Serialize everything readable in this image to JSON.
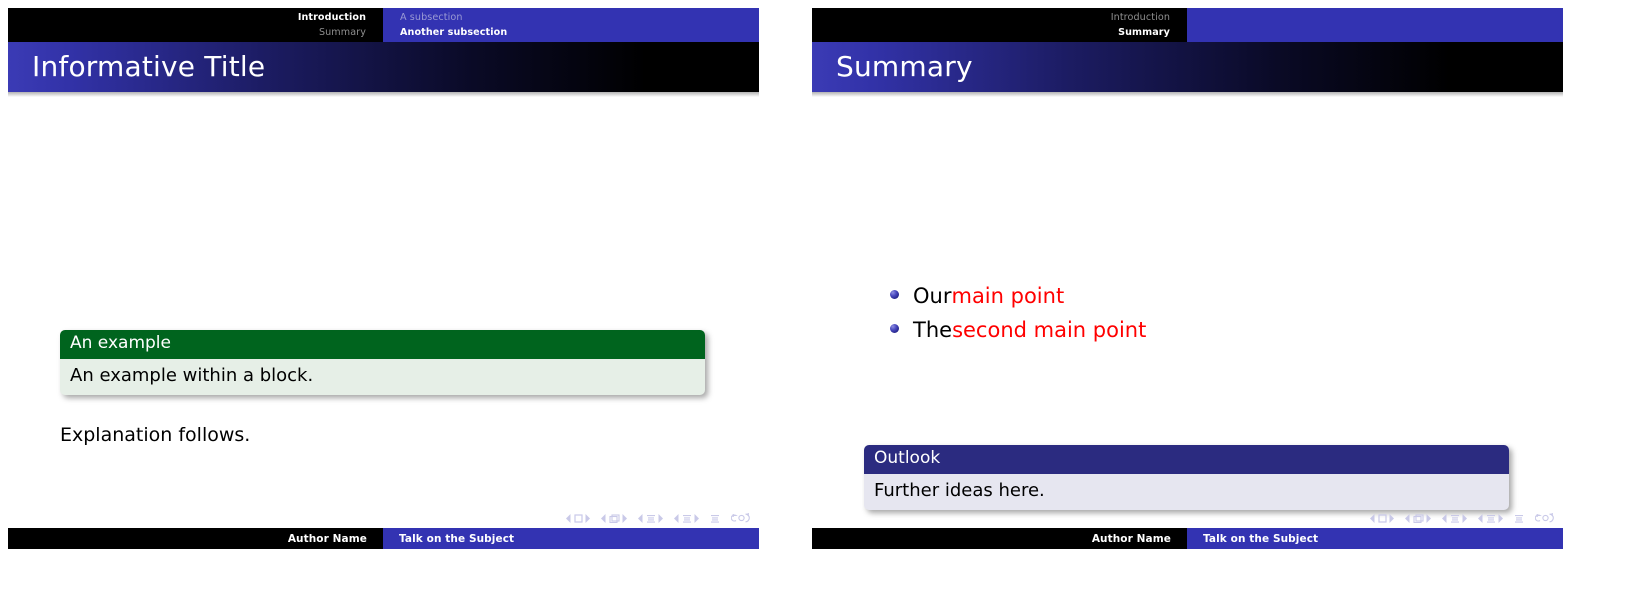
{
  "slides": [
    {
      "id": "slide-left",
      "nav": {
        "sections": [
          {
            "label": "Introduction",
            "state": "active"
          },
          {
            "label": "Summary",
            "state": "inactive"
          }
        ],
        "subsections": [
          {
            "label": "A subsection",
            "state": "inactive"
          },
          {
            "label": "Another subsection",
            "state": "active"
          }
        ]
      },
      "title": "Informative Title",
      "blocks": [
        {
          "kind": "example",
          "title": "An example",
          "body": "An example within a block."
        }
      ],
      "paragraph": "Explanation follows.",
      "footer": {
        "author": "Author Name",
        "talk": "Talk on the Subject"
      }
    },
    {
      "id": "slide-right",
      "nav": {
        "sections": [
          {
            "label": "Introduction",
            "state": "inactive"
          },
          {
            "label": "Summary",
            "state": "active"
          }
        ],
        "subsections": []
      },
      "title": "Summary",
      "items": [
        {
          "lead": "Our ",
          "alert": "main point"
        },
        {
          "lead": "The ",
          "alert": "second main point"
        }
      ],
      "blocks": [
        {
          "kind": "outlook",
          "title": "Outlook",
          "body": "Further ideas here."
        }
      ],
      "footer": {
        "author": "Author Name",
        "talk": "Talk on the Subject"
      }
    }
  ],
  "nav_symbols": [
    "beginning-slide",
    "previous-frame",
    "previous-subsection",
    "previous-section",
    "table-of-contents",
    "back-navigation"
  ],
  "colors": {
    "structure_blue": "#3333b2",
    "section_black": "#000000",
    "example_header_green": "#00641e",
    "example_body_green": "#e6efe7",
    "block_header_blue": "#2b2b80",
    "block_body_blue": "#e6e6f0",
    "alert_red": "#ff0000",
    "inactive_gray": "#8f8f8f",
    "nav_symbol_gray": "#c9c9e8"
  }
}
